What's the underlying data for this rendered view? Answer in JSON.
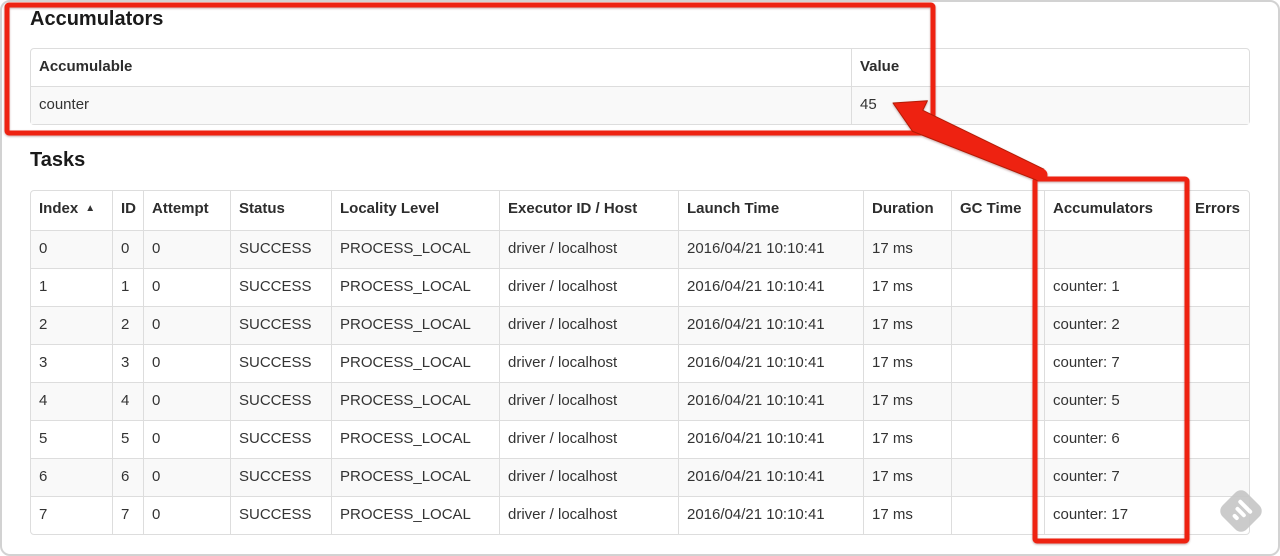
{
  "colors": {
    "annotation_red": "#ee2211",
    "row_stripe": "#f9f9f9",
    "table_border": "#dddddd"
  },
  "accumulators_section": {
    "title": "Accumulators",
    "table": {
      "headers": [
        "Accumulable",
        "Value"
      ],
      "rows": [
        [
          "counter",
          "45"
        ]
      ]
    }
  },
  "tasks_section": {
    "title": "Tasks",
    "table": {
      "sort_icon": "▲",
      "headers": [
        "Index",
        "ID",
        "Attempt",
        "Status",
        "Locality Level",
        "Executor ID / Host",
        "Launch Time",
        "Duration",
        "GC Time",
        "Accumulators",
        "Errors"
      ],
      "rows": [
        [
          "0",
          "0",
          "0",
          "SUCCESS",
          "PROCESS_LOCAL",
          "driver / localhost",
          "2016/04/21 10:10:41",
          "17 ms",
          "",
          "",
          ""
        ],
        [
          "1",
          "1",
          "0",
          "SUCCESS",
          "PROCESS_LOCAL",
          "driver / localhost",
          "2016/04/21 10:10:41",
          "17 ms",
          "",
          "counter: 1",
          ""
        ],
        [
          "2",
          "2",
          "0",
          "SUCCESS",
          "PROCESS_LOCAL",
          "driver / localhost",
          "2016/04/21 10:10:41",
          "17 ms",
          "",
          "counter: 2",
          ""
        ],
        [
          "3",
          "3",
          "0",
          "SUCCESS",
          "PROCESS_LOCAL",
          "driver / localhost",
          "2016/04/21 10:10:41",
          "17 ms",
          "",
          "counter: 7",
          ""
        ],
        [
          "4",
          "4",
          "0",
          "SUCCESS",
          "PROCESS_LOCAL",
          "driver / localhost",
          "2016/04/21 10:10:41",
          "17 ms",
          "",
          "counter: 5",
          ""
        ],
        [
          "5",
          "5",
          "0",
          "SUCCESS",
          "PROCESS_LOCAL",
          "driver / localhost",
          "2016/04/21 10:10:41",
          "17 ms",
          "",
          "counter: 6",
          ""
        ],
        [
          "6",
          "6",
          "0",
          "SUCCESS",
          "PROCESS_LOCAL",
          "driver / localhost",
          "2016/04/21 10:10:41",
          "17 ms",
          "",
          "counter: 7",
          ""
        ],
        [
          "7",
          "7",
          "0",
          "SUCCESS",
          "PROCESS_LOCAL",
          "driver / localhost",
          "2016/04/21 10:10:41",
          "17 ms",
          "",
          "counter: 17",
          ""
        ]
      ]
    }
  }
}
